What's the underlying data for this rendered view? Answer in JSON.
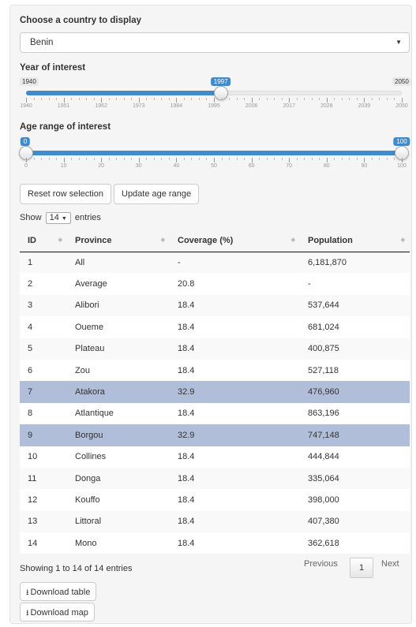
{
  "country": {
    "label": "Choose a country to display",
    "selected": "Benin"
  },
  "year": {
    "label": "Year of interest",
    "min": "1940",
    "max": "2050",
    "value": "1997",
    "value_num": 1997,
    "range": [
      1940,
      2050
    ],
    "ticks": [
      "1940",
      "1951",
      "1962",
      "1973",
      "1984",
      "1995",
      "2006",
      "2017",
      "2028",
      "2039",
      "2050"
    ]
  },
  "age": {
    "label": "Age range of interest",
    "from": "0",
    "to": "100",
    "ticks": [
      "0",
      "10",
      "20",
      "30",
      "40",
      "50",
      "60",
      "70",
      "80",
      "90",
      "100"
    ]
  },
  "buttons": {
    "reset": "Reset row selection",
    "update": "Update age range"
  },
  "table": {
    "show_prefix": "Show",
    "page_size": "14",
    "show_suffix": "entries",
    "headers": [
      "ID",
      "Province",
      "Coverage (%)",
      "Population"
    ],
    "rows": [
      {
        "id": "1",
        "province": "All",
        "coverage": "-",
        "population": "6,181,870",
        "selected": false
      },
      {
        "id": "2",
        "province": "Average",
        "coverage": "20.8",
        "population": "-",
        "selected": false
      },
      {
        "id": "3",
        "province": "Alibori",
        "coverage": "18.4",
        "population": "537,644",
        "selected": false
      },
      {
        "id": "4",
        "province": "Oueme",
        "coverage": "18.4",
        "population": "681,024",
        "selected": false
      },
      {
        "id": "5",
        "province": "Plateau",
        "coverage": "18.4",
        "population": "400,875",
        "selected": false
      },
      {
        "id": "6",
        "province": "Zou",
        "coverage": "18.4",
        "population": "527,118",
        "selected": false
      },
      {
        "id": "7",
        "province": "Atakora",
        "coverage": "32.9",
        "population": "476,960",
        "selected": true
      },
      {
        "id": "8",
        "province": "Atlantique",
        "coverage": "18.4",
        "population": "863,196",
        "selected": false
      },
      {
        "id": "9",
        "province": "Borgou",
        "coverage": "32.9",
        "population": "747,148",
        "selected": true
      },
      {
        "id": "10",
        "province": "Collines",
        "coverage": "18.4",
        "population": "444,844",
        "selected": false
      },
      {
        "id": "11",
        "province": "Donga",
        "coverage": "18.4",
        "population": "335,064",
        "selected": false
      },
      {
        "id": "12",
        "province": "Kouffo",
        "coverage": "18.4",
        "population": "398,000",
        "selected": false
      },
      {
        "id": "13",
        "province": "Littoral",
        "coverage": "18.4",
        "population": "407,380",
        "selected": false
      },
      {
        "id": "14",
        "province": "Mono",
        "coverage": "18.4",
        "population": "362,618",
        "selected": false
      }
    ],
    "info": "Showing 1 to 14 of 14 entries"
  },
  "pagination": {
    "previous": "Previous",
    "current": "1",
    "next": "Next"
  },
  "downloads": {
    "table": "Download table",
    "map": "Download map"
  },
  "colors": {
    "accent": "#428bca",
    "selected_row": "#b0bed9"
  }
}
